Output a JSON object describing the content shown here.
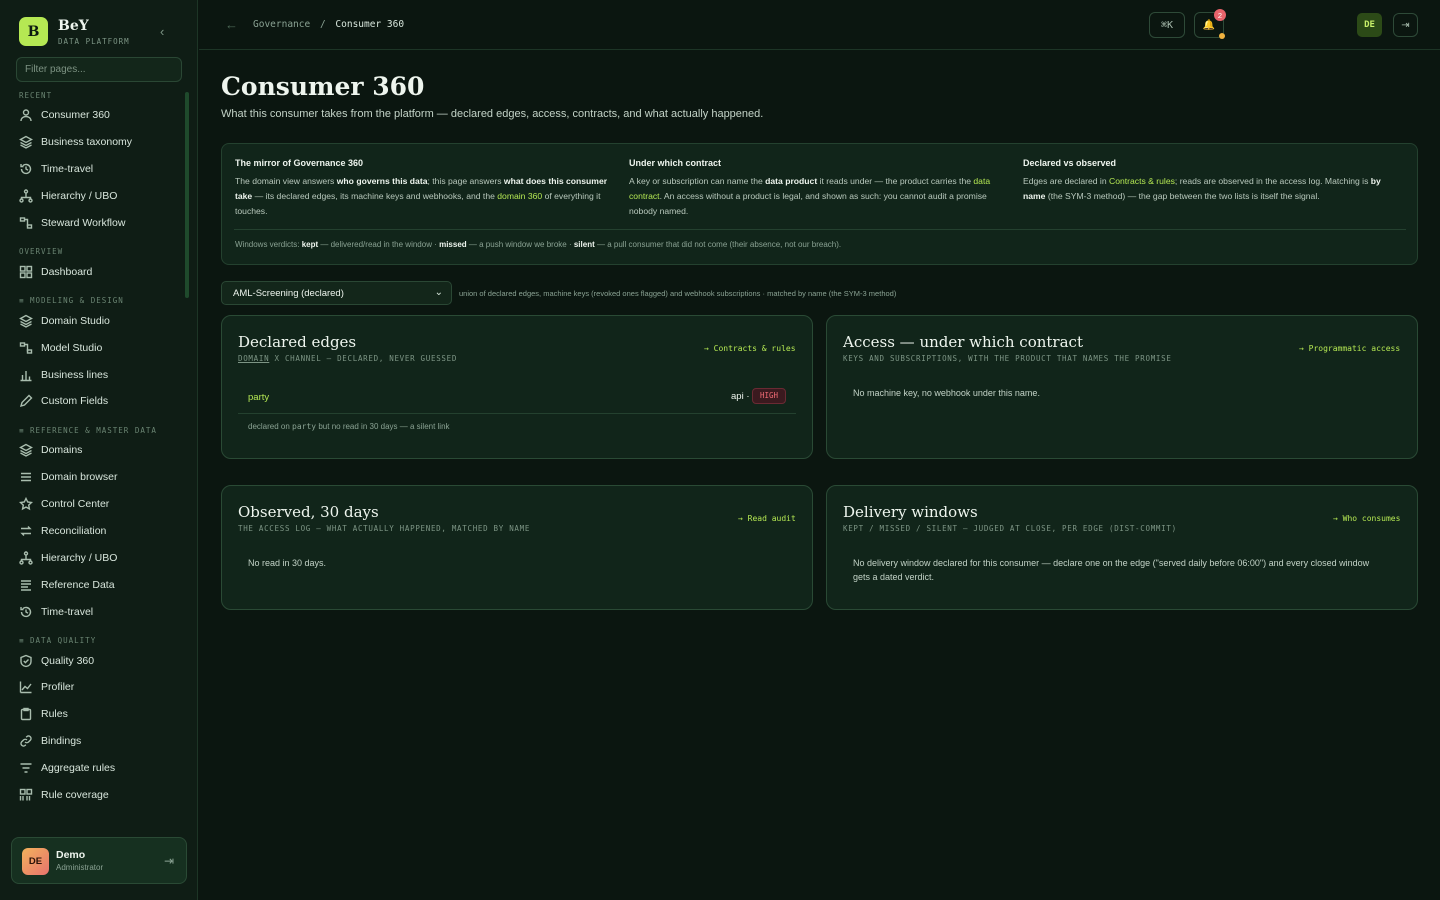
{
  "sidebar": {
    "brand_initial": "B",
    "brand_name": "BeY",
    "brand_sub": "DATA PLATFORM",
    "filter_placeholder": "Filter pages...",
    "sections": [
      {
        "label": "RECENT",
        "items": [
          {
            "label": "Consumer 360",
            "icon": "user-icon"
          },
          {
            "label": "Business taxonomy",
            "icon": "layers-icon"
          },
          {
            "label": "Time-travel",
            "icon": "history-icon"
          },
          {
            "label": "Hierarchy / UBO",
            "icon": "hierarchy-icon"
          },
          {
            "label": "Steward Workflow",
            "icon": "workflow-icon"
          }
        ]
      },
      {
        "label": "OVERVIEW",
        "items": [
          {
            "label": "Dashboard",
            "icon": "grid-icon"
          }
        ]
      },
      {
        "label": "≡ MODELING & DESIGN",
        "items": [
          {
            "label": "Domain Studio",
            "icon": "layers-icon"
          },
          {
            "label": "Model Studio",
            "icon": "workflow-icon"
          },
          {
            "label": "Business lines",
            "icon": "bar-chart-icon"
          },
          {
            "label": "Custom Fields",
            "icon": "pencil-icon"
          }
        ]
      },
      {
        "label": "≡ REFERENCE & MASTER DATA",
        "items": [
          {
            "label": "Domains",
            "icon": "layers-icon"
          },
          {
            "label": "Domain browser",
            "icon": "list-icon"
          },
          {
            "label": "Control Center",
            "icon": "star-icon"
          },
          {
            "label": "Reconciliation",
            "icon": "swap-icon"
          },
          {
            "label": "Hierarchy / UBO",
            "icon": "hierarchy-icon"
          },
          {
            "label": "Reference Data",
            "icon": "table-icon"
          },
          {
            "label": "Time-travel",
            "icon": "history-icon"
          }
        ]
      },
      {
        "label": "≡ DATA QUALITY",
        "items": [
          {
            "label": "Quality 360",
            "icon": "shield-check-icon"
          },
          {
            "label": "Profiler",
            "icon": "line-chart-icon"
          },
          {
            "label": "Rules",
            "icon": "clipboard-icon"
          },
          {
            "label": "Bindings",
            "icon": "link-icon"
          },
          {
            "label": "Aggregate rules",
            "icon": "filter-icon"
          },
          {
            "label": "Rule coverage",
            "icon": "coverage-icon"
          }
        ]
      }
    ],
    "user": {
      "initials": "DE",
      "name": "Demo",
      "role": "Administrator"
    }
  },
  "topbar": {
    "breadcrumb_parent": "Governance",
    "breadcrumb_sep": "/",
    "breadcrumb_current": "Consumer 360",
    "shortcut_label": "⌘K",
    "notif_count": "2",
    "avatar": "DE"
  },
  "page": {
    "title": "Consumer 360",
    "subtitle": "What this consumer takes from the platform — declared edges, access, contracts, and what actually happened."
  },
  "info": {
    "col1_title": "The mirror of Governance 360",
    "col2_title": "Under which contract",
    "col3_title": "Declared vs observed"
  },
  "consumer_select": {
    "value": "AML-Screening (declared)",
    "hint": "union of declared edges, machine keys (revoked ones flagged) and webhook subscriptions · matched by name (the SYM-3 method)"
  },
  "cards": {
    "declared": {
      "title": "Declared edges",
      "link": "→ Contracts & rules",
      "edge_name": "party",
      "edge_channel": "api ·",
      "edge_badge": "HIGH"
    },
    "access": {
      "title": "Access — under which contract",
      "subtitle": "KEYS AND SUBSCRIPTIONS, WITH THE PRODUCT THAT NAMES THE PROMISE",
      "link": "→ Programmatic access",
      "body": "No machine key, no webhook under this name."
    },
    "observed": {
      "title": "Observed, 30 days",
      "subtitle": "THE ACCESS LOG — WHAT ACTUALLY HAPPENED, MATCHED BY NAME",
      "link": "→ Read audit",
      "body": "No read in 30 days."
    },
    "delivery": {
      "title": "Delivery windows",
      "subtitle": "KEPT / MISSED / SILENT — JUDGED AT CLOSE, PER EDGE (DIST-COMMIT)",
      "link": "→ Who consumes",
      "body": "No delivery window declared for this consumer — declare one on the edge (\"served daily before 06:00\") and every closed window gets a dated verdict."
    }
  },
  "colors": {
    "accent": "#b5e853",
    "background": "#0b1610",
    "panel": "#11251a",
    "danger": "#f06b74"
  }
}
